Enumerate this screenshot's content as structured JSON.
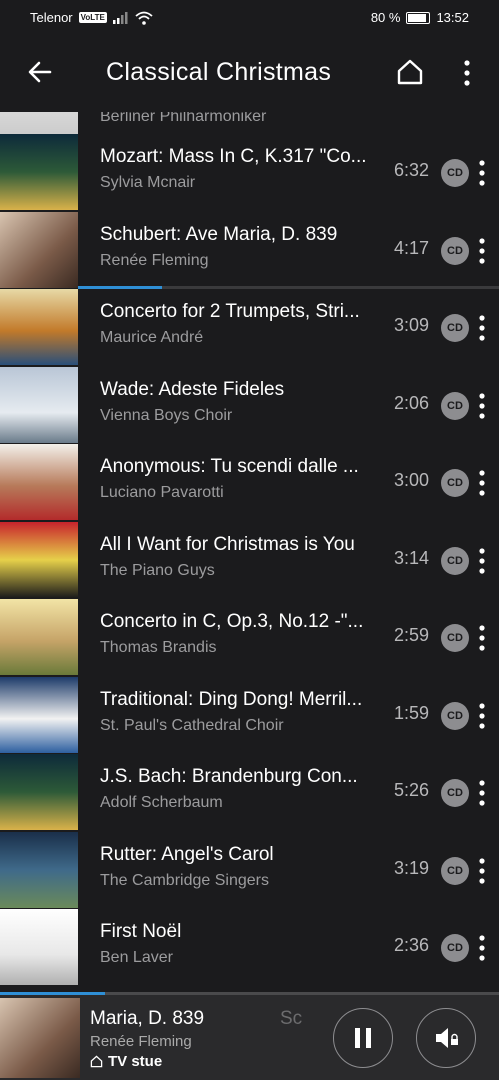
{
  "status": {
    "carrier": "Telenor",
    "volte": "VoLTE",
    "battery": "80 %",
    "battery_level": 0.8,
    "time": "13:52"
  },
  "appbar": {
    "title": "Classical Christmas",
    "back_icon": "arrow-left-icon",
    "home_icon": "home-icon",
    "menu_icon": "more-vertical-icon"
  },
  "partial_track": {
    "artist": "Berliner Philharmoniker"
  },
  "tracks": [
    {
      "title": "Mozart: Mass In C, K.317 \"Co...",
      "artist": "Sylvia Mcnair",
      "duration": "6:32",
      "badge": "CD"
    },
    {
      "title": "Schubert: Ave Maria, D. 839",
      "artist": "Renée Fleming",
      "duration": "4:17",
      "badge": "CD"
    },
    {
      "title": "Concerto for 2 Trumpets, Stri...",
      "artist": "Maurice André",
      "duration": "3:09",
      "badge": "CD"
    },
    {
      "title": "Wade: Adeste Fideles",
      "artist": "Vienna Boys Choir",
      "duration": "2:06",
      "badge": "CD"
    },
    {
      "title": "Anonymous: Tu scendi dalle ...",
      "artist": "Luciano Pavarotti",
      "duration": "3:00",
      "badge": "CD"
    },
    {
      "title": "All I Want for Christmas is You",
      "artist": "The Piano Guys",
      "duration": "3:14",
      "badge": "CD"
    },
    {
      "title": "Concerto in C, Op.3, No.12 -\"...",
      "artist": "Thomas Brandis",
      "duration": "2:59",
      "badge": "CD"
    },
    {
      "title": "Traditional: Ding Dong! Merril...",
      "artist": "St. Paul's Cathedral Choir",
      "duration": "1:59",
      "badge": "CD"
    },
    {
      "title": "J.S. Bach: Brandenburg Con...",
      "artist": "Adolf Scherbaum",
      "duration": "5:26",
      "badge": "CD"
    },
    {
      "title": "Rutter: Angel's Carol",
      "artist": "The Cambridge Singers",
      "duration": "3:19",
      "badge": "CD"
    },
    {
      "title": "First Noël",
      "artist": "Ben Laver",
      "duration": "2:36",
      "badge": "CD"
    }
  ],
  "current_track_progress": 0.2,
  "now_playing": {
    "title": "Maria, D. 839",
    "title_next": "Sc",
    "artist": "Renée Fleming",
    "room": "TV stue",
    "progress": 0.21,
    "pause_icon": "pause-icon",
    "volume_icon": "volume-lock-icon"
  },
  "colors": {
    "background": "#1b1b1d",
    "accent": "#2f8fd6",
    "badge": "#8d8d90"
  }
}
